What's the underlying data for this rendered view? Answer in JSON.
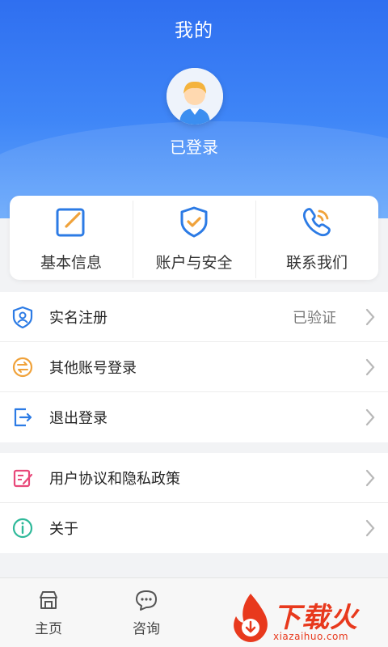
{
  "header": {
    "title": "我的",
    "login_status": "已登录"
  },
  "quick_actions": [
    {
      "label": "基本信息",
      "icon": "edit-icon"
    },
    {
      "label": "账户与安全",
      "icon": "shield-check-icon"
    },
    {
      "label": "联系我们",
      "icon": "phone-icon"
    }
  ],
  "menu_group_1": [
    {
      "label": "实名注册",
      "value": "已验证",
      "icon": "id-verify-icon"
    },
    {
      "label": "其他账号登录",
      "icon": "switch-account-icon"
    },
    {
      "label": "退出登录",
      "icon": "logout-icon"
    }
  ],
  "menu_group_2": [
    {
      "label": "用户协议和隐私政策",
      "icon": "agreement-icon"
    },
    {
      "label": "关于",
      "icon": "info-icon"
    }
  ],
  "tabbar": [
    {
      "label": "主页",
      "icon": "home-icon"
    },
    {
      "label": "咨询",
      "icon": "chat-icon"
    }
  ],
  "watermark": {
    "text": "下载火",
    "url": "xiazaihuo.com"
  },
  "colors": {
    "header_top": "#2f6ff0",
    "header_bottom": "#64a6fb",
    "accent_blue": "#2c7be5",
    "accent_orange": "#f0a23a",
    "pink": "#e8497a",
    "teal": "#2fb99a",
    "watermark_red": "#e8391d"
  }
}
